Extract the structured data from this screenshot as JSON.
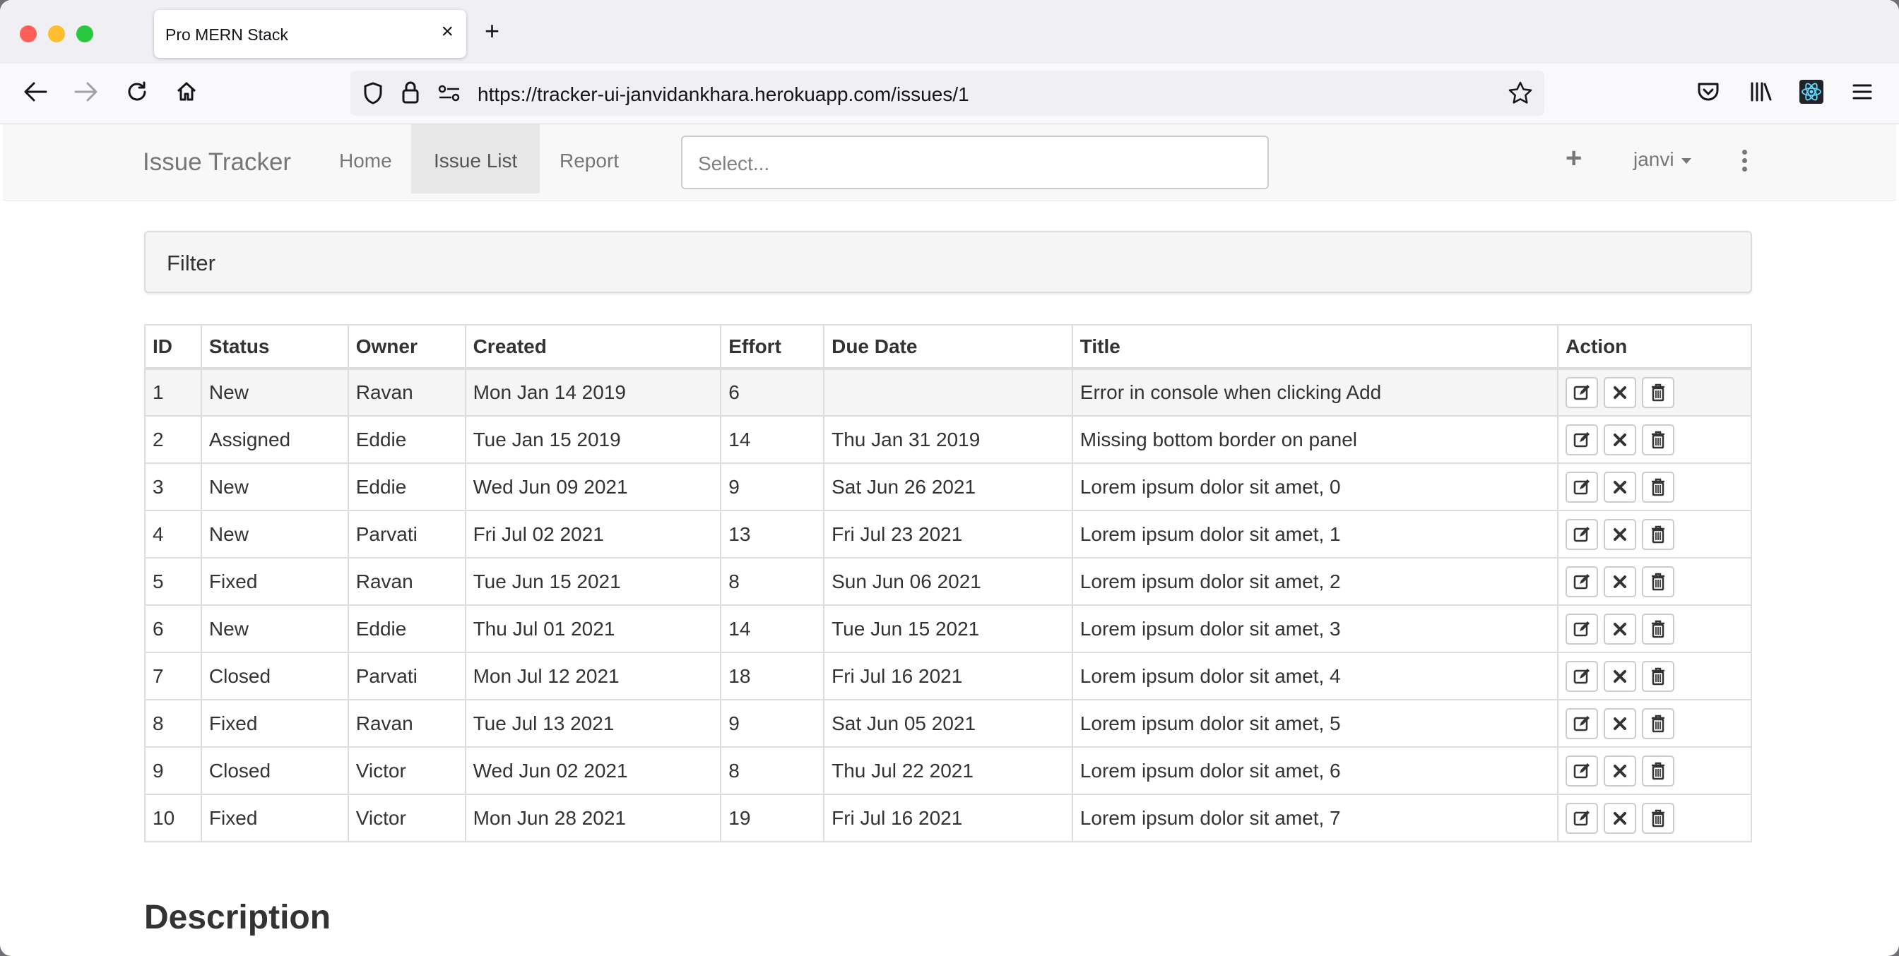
{
  "browser": {
    "tab_title": "Pro MERN Stack",
    "url": "https://tracker-ui-janvidankhara.herokuapp.com/issues/1"
  },
  "navbar": {
    "brand": "Issue Tracker",
    "links": [
      {
        "label": "Home",
        "active": false
      },
      {
        "label": "Issue List",
        "active": true
      },
      {
        "label": "Report",
        "active": false
      }
    ],
    "search_placeholder": "Select...",
    "user": "janvi"
  },
  "filter": {
    "title": "Filter"
  },
  "table": {
    "headers": [
      "ID",
      "Status",
      "Owner",
      "Created",
      "Effort",
      "Due Date",
      "Title",
      "Action"
    ],
    "rows": [
      {
        "id": "1",
        "status": "New",
        "owner": "Ravan",
        "created": "Mon Jan 14 2019",
        "effort": "6",
        "due": "",
        "title": "Error in console when clicking Add"
      },
      {
        "id": "2",
        "status": "Assigned",
        "owner": "Eddie",
        "created": "Tue Jan 15 2019",
        "effort": "14",
        "due": "Thu Jan 31 2019",
        "title": "Missing bottom border on panel"
      },
      {
        "id": "3",
        "status": "New",
        "owner": "Eddie",
        "created": "Wed Jun 09 2021",
        "effort": "9",
        "due": "Sat Jun 26 2021",
        "title": "Lorem ipsum dolor sit amet, 0"
      },
      {
        "id": "4",
        "status": "New",
        "owner": "Parvati",
        "created": "Fri Jul 02 2021",
        "effort": "13",
        "due": "Fri Jul 23 2021",
        "title": "Lorem ipsum dolor sit amet, 1"
      },
      {
        "id": "5",
        "status": "Fixed",
        "owner": "Ravan",
        "created": "Tue Jun 15 2021",
        "effort": "8",
        "due": "Sun Jun 06 2021",
        "title": "Lorem ipsum dolor sit amet, 2"
      },
      {
        "id": "6",
        "status": "New",
        "owner": "Eddie",
        "created": "Thu Jul 01 2021",
        "effort": "14",
        "due": "Tue Jun 15 2021",
        "title": "Lorem ipsum dolor sit amet, 3"
      },
      {
        "id": "7",
        "status": "Closed",
        "owner": "Parvati",
        "created": "Mon Jul 12 2021",
        "effort": "18",
        "due": "Fri Jul 16 2021",
        "title": "Lorem ipsum dolor sit amet, 4"
      },
      {
        "id": "8",
        "status": "Fixed",
        "owner": "Ravan",
        "created": "Tue Jul 13 2021",
        "effort": "9",
        "due": "Sat Jun 05 2021",
        "title": "Lorem ipsum dolor sit amet, 5"
      },
      {
        "id": "9",
        "status": "Closed",
        "owner": "Victor",
        "created": "Wed Jun 02 2021",
        "effort": "8",
        "due": "Thu Jul 22 2021",
        "title": "Lorem ipsum dolor sit amet, 6"
      },
      {
        "id": "10",
        "status": "Fixed",
        "owner": "Victor",
        "created": "Mon Jun 28 2021",
        "effort": "19",
        "due": "Fri Jul 16 2021",
        "title": "Lorem ipsum dolor sit amet, 7"
      }
    ],
    "row_actions": [
      "edit-icon",
      "close-icon",
      "trash-icon"
    ]
  },
  "description": {
    "heading": "Description"
  },
  "colors": {
    "navbar_bg": "#f8f8f8",
    "active_link_bg": "#e7e7e7",
    "panel_bg": "#f5f5f5",
    "border": "#dddddd"
  }
}
